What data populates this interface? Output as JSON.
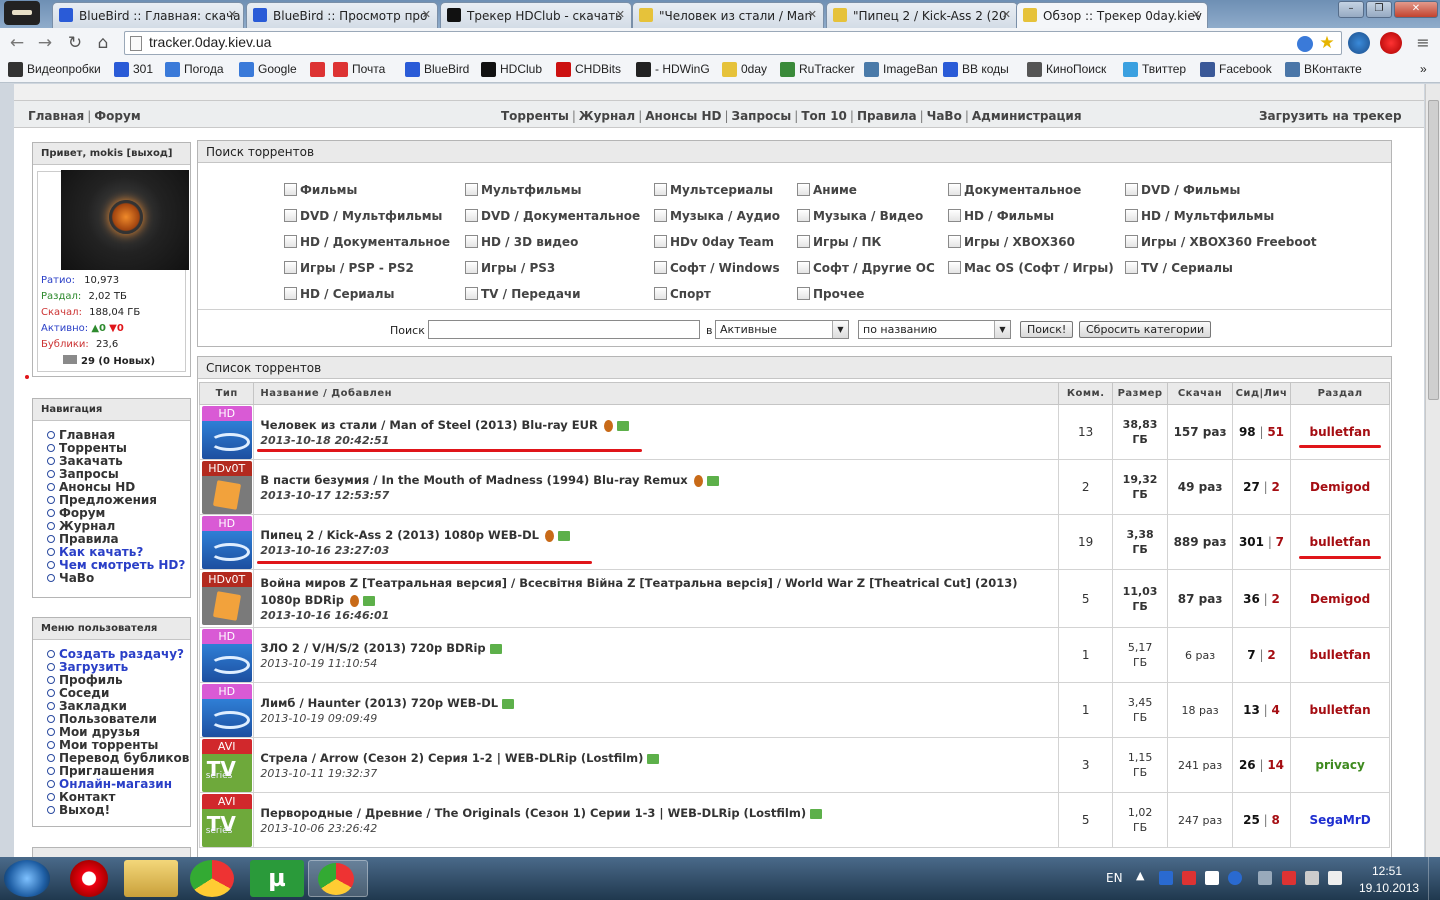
{
  "browser": {
    "tabs": [
      {
        "title": "BlueBird :: Главная: скача",
        "color": "#2a5bd7"
      },
      {
        "title": "BlueBird :: Просмотр про",
        "color": "#2a5bd7"
      },
      {
        "title": "Трекер HDClub - скачать",
        "color": "#111111"
      },
      {
        "title": "\"Человек из стали / Man",
        "color": "#e6c23a"
      },
      {
        "title": "\"Пипец 2 / Kick-Ass 2 (20",
        "color": "#e6c23a"
      },
      {
        "title": "Обзор :: Трекер 0day.kiev",
        "color": "#e6c23a"
      }
    ],
    "url": "tracker.0day.kiev.ua",
    "bookmarks": [
      {
        "label": "Видеопробки",
        "color": "#333333"
      },
      {
        "label": "301",
        "color": "#2a5bd7"
      },
      {
        "label": "Погода",
        "color": "#3a7ad9"
      },
      {
        "label": "Google",
        "color": "#3a7ad9"
      },
      {
        "label": "",
        "color": "#d33"
      },
      {
        "label": "Почта",
        "color": "#d33"
      },
      {
        "label": "BlueBird",
        "color": "#2a5bd7"
      },
      {
        "label": "HDClub",
        "color": "#111111"
      },
      {
        "label": "CHDBits",
        "color": "#c11"
      },
      {
        "label": "- HDWinG",
        "color": "#222222"
      },
      {
        "label": "0day",
        "color": "#e6c23a"
      },
      {
        "label": "RuTracker",
        "color": "#3a8a3a"
      },
      {
        "label": "ImageBan",
        "color": "#4a7aa9"
      },
      {
        "label": "BB коды",
        "color": "#2a5bd7"
      },
      {
        "label": "КиноПоиск",
        "color": "#555555"
      },
      {
        "label": "Твиттер",
        "color": "#3aa0e0"
      },
      {
        "label": "Facebook",
        "color": "#3b5998"
      },
      {
        "label": "ВКонтакте",
        "color": "#4a76a8"
      }
    ],
    "more_bookmarks": "»"
  },
  "menu": {
    "left": [
      "Главная",
      "Форум"
    ],
    "center": [
      "Торренты",
      "Журнал",
      "Анонсы HD",
      "Запросы",
      "Топ 10",
      "Правила",
      "ЧаВо",
      "Администрация"
    ],
    "right": "Загрузить на трекер",
    "separator": "|"
  },
  "profile": {
    "greeting": "Привет,",
    "username": "mokis",
    "logout": "[выход]",
    "ratio_label": "Ратио:",
    "ratio": "10,973",
    "uploaded_label": "Раздал:",
    "uploaded": "2,02 ТБ",
    "downloaded_label": "Скачал:",
    "downloaded": "188,04 ГБ",
    "active_label": "Активно:",
    "active_up": "0",
    "active_down": "0",
    "bonus_label": "Бублики:",
    "bonus": "23,6",
    "messages": "29 (0 Новых)"
  },
  "navigation": {
    "title": "Навигация",
    "items": [
      {
        "label": "Главная",
        "blue": false
      },
      {
        "label": "Торренты",
        "blue": false
      },
      {
        "label": "Закачать",
        "blue": false
      },
      {
        "label": "Запросы",
        "blue": false
      },
      {
        "label": "Анонсы HD",
        "blue": false
      },
      {
        "label": "Предложения",
        "blue": false
      },
      {
        "label": "Форум",
        "blue": false
      },
      {
        "label": "Журнал",
        "blue": false
      },
      {
        "label": "Правила",
        "blue": false
      },
      {
        "label": "Как качать?",
        "blue": true
      },
      {
        "label": "Чем смотреть HD?",
        "blue": true
      },
      {
        "label": "ЧаВо",
        "blue": false
      }
    ]
  },
  "user_menu": {
    "title": "Меню пользователя",
    "items": [
      {
        "label": "Создать раздачу?",
        "blue": true
      },
      {
        "label": "Загрузить",
        "blue": true
      },
      {
        "label": "Профиль",
        "blue": false
      },
      {
        "label": "Соседи",
        "blue": false
      },
      {
        "label": "Закладки",
        "blue": false
      },
      {
        "label": "Пользователи",
        "blue": false
      },
      {
        "label": "Мои друзья",
        "blue": false
      },
      {
        "label": "Мои торренты",
        "blue": false
      },
      {
        "label": "Перевод бубликов",
        "blue": false
      },
      {
        "label": "Приглашения",
        "blue": false
      },
      {
        "label": "Онлайн-магазин",
        "blue": true
      },
      {
        "label": "Контакт",
        "blue": false
      },
      {
        "label": "Выход!",
        "blue": false
      }
    ]
  },
  "search": {
    "title": "Поиск торрентов",
    "categories": [
      [
        "Фильмы",
        "Мультфильмы",
        "Мультсериалы",
        "Аниме",
        "Документальное",
        "DVD / Фильмы"
      ],
      [
        "DVD / Мультфильмы",
        "DVD / Документальное",
        "Музыка / Аудио",
        "Музыка / Видео",
        "HD / Фильмы",
        "HD / Мультфильмы"
      ],
      [
        "HD / Документальное",
        "HD / 3D видео",
        "HDv 0day Team",
        "Игры / ПК",
        "Игры / XBOX360",
        "Игры / XBOX360 Freeboot"
      ],
      [
        "Игры / PSP - PS2",
        "Игры / PS3",
        "Софт / Windows",
        "Софт / Другие ОС",
        "Mac OS (Софт / Игры)",
        "TV / Сериалы"
      ],
      [
        "HD / Сериалы",
        "TV / Передачи",
        "Спорт",
        "Прочее",
        "",
        ""
      ]
    ],
    "search_label": "Поиск",
    "query": "",
    "in_label": "в",
    "scope": "Активные",
    "sort": "по названию",
    "submit": "Поиск!",
    "reset": "Сбросить категории"
  },
  "torrents": {
    "title": "Список торрентов",
    "columns": [
      "Тип",
      "Название / Добавлен",
      "Комм.",
      "Размер",
      "Скачан",
      "Сид|Лич",
      "Раздал"
    ],
    "rows": [
      {
        "cat": "hd",
        "cat_label": "HD",
        "name": "Человек из стали / Man of Steel (2013) Blu-ray EUR",
        "date": "2013-10-18 20:42:51",
        "date_bold": true,
        "comments": "13",
        "size_value": "38,83",
        "size_unit": "ГБ",
        "size_bold": true,
        "snatched": "157 раз",
        "snatched_bold": true,
        "seeders": "98",
        "leechers": "51",
        "uploader": "bulletfan",
        "uploader_color": "#a50d12",
        "two_line": false,
        "marks": true
      },
      {
        "cat": "hdv",
        "cat_label": "HDv0T",
        "name": "В пасти безумия / In the Mouth of Madness (1994) Blu-ray Remux",
        "date": "2013-10-17 12:53:57",
        "date_bold": true,
        "comments": "2",
        "size_value": "19,32",
        "size_unit": "ГБ",
        "size_bold": true,
        "snatched": "49 раз",
        "snatched_bold": true,
        "seeders": "27",
        "leechers": "2",
        "uploader": "Demigod",
        "uploader_color": "#a50d12",
        "two_line": false,
        "marks": true
      },
      {
        "cat": "hd",
        "cat_label": "HD",
        "name": "Пипец 2 / Kick-Ass 2 (2013) 1080p WEB-DL",
        "date": "2013-10-16 23:27:03",
        "date_bold": true,
        "comments": "19",
        "size_value": "3,38",
        "size_unit": "ГБ",
        "size_bold": true,
        "snatched": "889 раз",
        "snatched_bold": true,
        "seeders": "301",
        "leechers": "7",
        "uploader": "bulletfan",
        "uploader_color": "#a50d12",
        "two_line": false,
        "marks": true
      },
      {
        "cat": "hdv",
        "cat_label": "HDv0T",
        "name": "Война миров Z [Театральная версия] / Всесвітня Війна Z [Театральна версія] / World War Z [Theatrical Cut] (2013) 1080p BDRip",
        "date": "2013-10-16 16:46:01",
        "date_bold": true,
        "comments": "5",
        "size_value": "11,03",
        "size_unit": "ГБ",
        "size_bold": true,
        "snatched": "87 раз",
        "snatched_bold": true,
        "seeders": "36",
        "leechers": "2",
        "uploader": "Demigod",
        "uploader_color": "#a50d12",
        "two_line": true,
        "marks": true
      },
      {
        "cat": "hd",
        "cat_label": "HD",
        "name": "ЗЛО 2 / V/H/S/2 (2013) 720p BDRip",
        "date": "2013-10-19 11:10:54",
        "date_bold": false,
        "comments": "1",
        "size_value": "5,17",
        "size_unit": "ГБ",
        "size_bold": false,
        "snatched": "6 раз",
        "snatched_bold": false,
        "seeders": "7",
        "leechers": "2",
        "uploader": "bulletfan",
        "uploader_color": "#a50d12",
        "two_line": false,
        "marks": false
      },
      {
        "cat": "hd",
        "cat_label": "HD",
        "name": "Лимб / Haunter (2013) 720p WEB-DL",
        "date": "2013-10-19 09:09:49",
        "date_bold": false,
        "comments": "1",
        "size_value": "3,45",
        "size_unit": "ГБ",
        "size_bold": false,
        "snatched": "18 раз",
        "snatched_bold": false,
        "seeders": "13",
        "leechers": "4",
        "uploader": "bulletfan",
        "uploader_color": "#a50d12",
        "two_line": false,
        "marks": false
      },
      {
        "cat": "avi",
        "cat_label": "AVI",
        "name": "Стрела / Arrow (Сезон 2) Серия 1-2 | WEB-DLRip (Lostfilm)",
        "date": "2013-10-11 19:32:37",
        "date_bold": false,
        "comments": "3",
        "size_value": "1,15",
        "size_unit": "ГБ",
        "size_bold": false,
        "snatched": "241 раз",
        "snatched_bold": false,
        "seeders": "26",
        "leechers": "14",
        "uploader": "privacy",
        "uploader_color": "#3e8a1e",
        "two_line": false,
        "marks": false
      },
      {
        "cat": "avi",
        "cat_label": "AVI",
        "name": "Первородные / Древние / The Originals (Сезон 1) Серии 1-3 | WEB-DLRip (Lostfilm)",
        "date": "2013-10-06 23:26:42",
        "date_bold": false,
        "comments": "5",
        "size_value": "1,02",
        "size_unit": "ГБ",
        "size_bold": false,
        "snatched": "247 раз",
        "snatched_bold": false,
        "seeders": "25",
        "leechers": "8",
        "uploader": "SegaMrD",
        "uploader_color": "#1f2fd0",
        "two_line": false,
        "marks": false
      }
    ],
    "tv_big": "TV",
    "tv_small": "series"
  },
  "taskbar": {
    "lang": "EN",
    "time": "12:51",
    "date": "19.10.2013"
  },
  "colors": {
    "link_blue": "#2a3fc7",
    "uploader_red": "#a50d12",
    "uploader_green": "#3e8a1e",
    "highlight_red": "#e0151a"
  }
}
